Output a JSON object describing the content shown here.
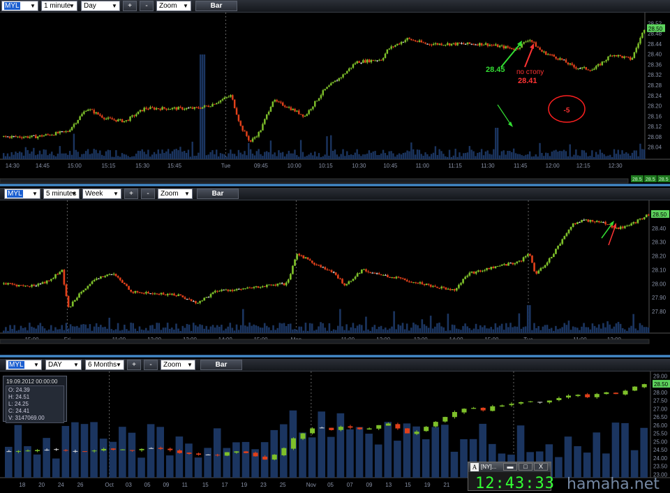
{
  "toolbars": [
    {
      "symbol": "MYL",
      "interval": "1 minute",
      "period": "Day",
      "plus": "+",
      "minus": "-",
      "zoom": "Zoom",
      "style": "Bar"
    },
    {
      "symbol": "MYL",
      "interval": "5 minutes",
      "period": "Week",
      "plus": "+",
      "minus": "-",
      "zoom": "Zoom",
      "style": "Bar"
    },
    {
      "symbol": "MYL",
      "interval": "DAY",
      "period": "6 Months",
      "plus": "+",
      "minus": "-",
      "zoom": "Zoom",
      "style": "Bar"
    }
  ],
  "colors": {
    "up": "#7ec02a",
    "down": "#e0401a",
    "flat": "#dddddd",
    "volume": "#1b3560",
    "axis_text": "#8a93a8",
    "price_label": "#33cc33"
  },
  "chart_data": [
    {
      "type": "candlestick",
      "interval": "1 minute",
      "y_ticks": [
        "28.52",
        "28.48",
        "28.44",
        "28.40",
        "28.36",
        "28.32",
        "28.28",
        "28.24",
        "28.20",
        "28.16",
        "28.12",
        "28.08",
        "28.04"
      ],
      "ylim": [
        28.02,
        28.54
      ],
      "x_ticks": [
        "14:30",
        "14:45",
        "15:00",
        "15:15",
        "15:30",
        "15:45",
        "Tue",
        "09:45",
        "10:00",
        "10:15",
        "10:30",
        "10:45",
        "11:00",
        "11:15",
        "11:30",
        "11:45",
        "12:00",
        "12:15",
        "12:30"
      ],
      "x_tick_pos": [
        0.015,
        0.062,
        0.112,
        0.165,
        0.218,
        0.268,
        0.348,
        0.403,
        0.455,
        0.504,
        0.556,
        0.605,
        0.655,
        0.706,
        0.757,
        0.808,
        0.858,
        0.906,
        0.956
      ],
      "session_break": 0.348,
      "price_path": [
        [
          0.0,
          28.08
        ],
        [
          0.05,
          28.08
        ],
        [
          0.1,
          28.1
        ],
        [
          0.13,
          28.19
        ],
        [
          0.16,
          28.15
        ],
        [
          0.19,
          28.14
        ],
        [
          0.22,
          28.19
        ],
        [
          0.3,
          28.19
        ],
        [
          0.32,
          28.2
        ],
        [
          0.355,
          28.24
        ],
        [
          0.37,
          28.12
        ],
        [
          0.385,
          28.06
        ],
        [
          0.4,
          28.1
        ],
        [
          0.42,
          28.22
        ],
        [
          0.44,
          28.2
        ],
        [
          0.47,
          28.16
        ],
        [
          0.5,
          28.26
        ],
        [
          0.53,
          28.32
        ],
        [
          0.55,
          28.37
        ],
        [
          0.59,
          28.38
        ],
        [
          0.6,
          28.42
        ],
        [
          0.63,
          28.46
        ],
        [
          0.66,
          28.44
        ],
        [
          0.7,
          28.44
        ],
        [
          0.75,
          28.44
        ],
        [
          0.8,
          28.42
        ],
        [
          0.82,
          28.46
        ],
        [
          0.84,
          28.41
        ],
        [
          0.87,
          28.38
        ],
        [
          0.89,
          28.35
        ],
        [
          0.92,
          28.34
        ],
        [
          0.95,
          28.4
        ],
        [
          0.98,
          28.38
        ],
        [
          1.0,
          28.5
        ]
      ],
      "current_price": "28.50",
      "annotations": [
        {
          "text": "28.45",
          "color": "#33dd33",
          "x": 0.765,
          "y": 28.37
        },
        {
          "text": "по стопу",
          "color": "#ff3333",
          "x": 0.815,
          "y": 28.36
        },
        {
          "text": "28.41",
          "color": "#ff3333",
          "x": 0.815,
          "y": 28.33
        },
        {
          "text": "-5",
          "color": "#ff3333",
          "x": 0.862,
          "y": 28.2
        }
      ],
      "status_values": [
        "28.5",
        "28.5",
        "28.5"
      ]
    },
    {
      "type": "candlestick",
      "interval": "5 minutes",
      "y_ticks": [
        "28.50",
        "28.40",
        "28.30",
        "28.20",
        "28.10",
        "28.00",
        "27.90",
        "27.80"
      ],
      "ylim": [
        27.72,
        28.56
      ],
      "x_ticks": [
        "15:00",
        "Fri",
        "11:00",
        "12:00",
        "13:00",
        "14:00",
        "15:00",
        "Mon",
        "11:00",
        "12:00",
        "13:00",
        "14:00",
        "15:00",
        "Tue",
        "11:00",
        "12:00"
      ],
      "x_tick_pos": [
        0.045,
        0.1,
        0.18,
        0.235,
        0.29,
        0.345,
        0.4,
        0.455,
        0.535,
        0.59,
        0.648,
        0.703,
        0.758,
        0.815,
        0.895,
        0.948
      ],
      "session_breaks": [
        0.1,
        0.455,
        0.815
      ],
      "price_path": [
        [
          0.0,
          28.0
        ],
        [
          0.04,
          27.98
        ],
        [
          0.07,
          28.02
        ],
        [
          0.09,
          28.1
        ],
        [
          0.1,
          27.82
        ],
        [
          0.12,
          27.95
        ],
        [
          0.15,
          28.05
        ],
        [
          0.17,
          28.07
        ],
        [
          0.2,
          27.94
        ],
        [
          0.23,
          27.93
        ],
        [
          0.27,
          27.92
        ],
        [
          0.3,
          27.86
        ],
        [
          0.33,
          27.95
        ],
        [
          0.37,
          27.96
        ],
        [
          0.4,
          27.98
        ],
        [
          0.44,
          28.0
        ],
        [
          0.455,
          28.22
        ],
        [
          0.48,
          28.15
        ],
        [
          0.51,
          28.08
        ],
        [
          0.53,
          27.99
        ],
        [
          0.555,
          28.1
        ],
        [
          0.59,
          28.06
        ],
        [
          0.62,
          28.03
        ],
        [
          0.65,
          28.0
        ],
        [
          0.68,
          27.97
        ],
        [
          0.7,
          27.96
        ],
        [
          0.72,
          28.07
        ],
        [
          0.76,
          28.12
        ],
        [
          0.8,
          28.16
        ],
        [
          0.815,
          28.22
        ],
        [
          0.825,
          28.06
        ],
        [
          0.85,
          28.2
        ],
        [
          0.88,
          28.42
        ],
        [
          0.9,
          28.46
        ],
        [
          0.93,
          28.44
        ],
        [
          0.95,
          28.4
        ],
        [
          0.97,
          28.42
        ],
        [
          0.99,
          28.47
        ],
        [
          1.0,
          28.5
        ]
      ],
      "current_price": "28.50"
    },
    {
      "type": "ohlc",
      "interval": "DAY",
      "y_ticks": [
        "29.00",
        "28.50",
        "28.00",
        "27.50",
        "27.00",
        "26.50",
        "26.00",
        "25.50",
        "25.00",
        "24.50",
        "24.00",
        "23.50",
        "23.00"
      ],
      "ylim": [
        22.8,
        29.1
      ],
      "x_ticks": [
        "18",
        "20",
        "24",
        "26",
        "Oct",
        "03",
        "05",
        "09",
        "11",
        "15",
        "17",
        "19",
        "23",
        "25",
        "Nov",
        "05",
        "07",
        "09",
        "13",
        "15",
        "19",
        "21"
      ],
      "x_tick_pos": [
        0.028,
        0.058,
        0.088,
        0.118,
        0.163,
        0.193,
        0.222,
        0.251,
        0.28,
        0.312,
        0.342,
        0.372,
        0.402,
        0.432,
        0.476,
        0.506,
        0.536,
        0.566,
        0.596,
        0.626,
        0.656,
        0.686
      ],
      "month_breaks": [
        0.163,
        0.476,
        0.79
      ],
      "daily_close": [
        24.41,
        24.42,
        24.45,
        24.48,
        24.5,
        24.52,
        24.45,
        24.4,
        24.38,
        24.45,
        24.55,
        24.5,
        24.52,
        24.45,
        24.55,
        24.6,
        24.55,
        24.48,
        24.3,
        24.25,
        24.2,
        24.18,
        24.15,
        24.35,
        24.4,
        24.3,
        24.1,
        23.9,
        24.2,
        24.6,
        25.2,
        25.5,
        25.8,
        25.85,
        25.7,
        25.9,
        25.85,
        25.75,
        25.8,
        26.0,
        26.1,
        25.8,
        25.5,
        25.6,
        25.9,
        26.2,
        26.5,
        26.8,
        27.0,
        27.05,
        26.9,
        27.15,
        27.2,
        27.3,
        27.4,
        27.45,
        27.4,
        27.5,
        27.65,
        27.8,
        27.85,
        27.7,
        27.9,
        28.0,
        27.9,
        28.1,
        28.35,
        28.5
      ],
      "current_price": "28.50",
      "info_box": {
        "date": "19.09.2012 00:00:00",
        "open": "O: 24.39",
        "high": "H: 24.51",
        "low": "L: 24.25",
        "close": "C: 24.41",
        "volume": "V: 3147069.00"
      }
    }
  ],
  "clock": {
    "label": "[NY]...",
    "min": "▬",
    "max": "□",
    "close": "X",
    "time": "12:43:33"
  },
  "watermark": "hamaha.net"
}
